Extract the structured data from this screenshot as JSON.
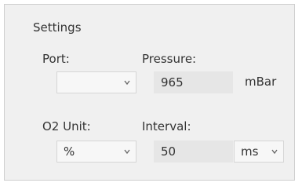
{
  "settings": {
    "title": "Settings",
    "port": {
      "label": "Port:",
      "value": ""
    },
    "pressure": {
      "label": "Pressure:",
      "value": "965",
      "unit": "mBar"
    },
    "o2_unit": {
      "label": "O2 Unit:",
      "value": "%"
    },
    "interval": {
      "label": "Interval:",
      "value": "50",
      "unit_value": "ms"
    }
  },
  "icons": {
    "dropdown": "chevron-down-icon"
  },
  "colors": {
    "panel_bg": "#f0f0f0",
    "textbox_bg": "#e6e6e6",
    "combo_bg": "#f7f7f7",
    "border": "#d6d6d6",
    "text": "#333333"
  }
}
